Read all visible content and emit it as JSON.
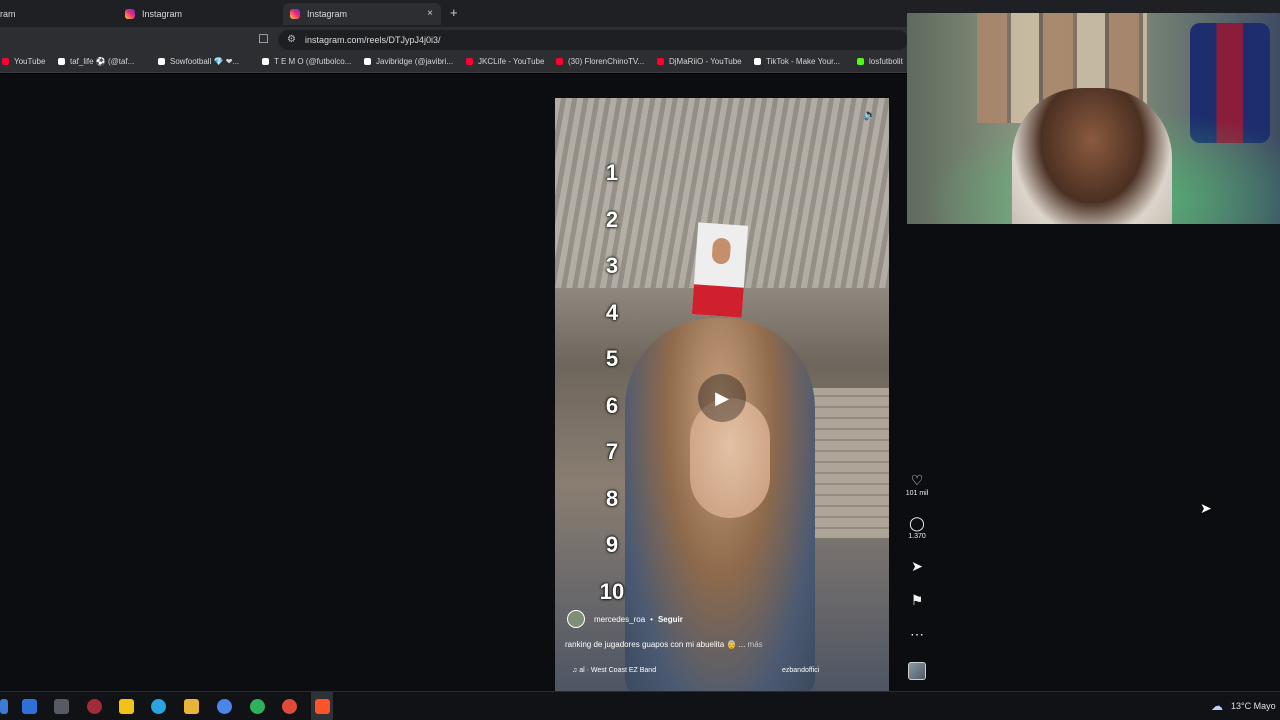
{
  "browser": {
    "tabs": [
      {
        "label": "ram",
        "active": false
      },
      {
        "label": "Instagram",
        "active": false
      },
      {
        "label": "Instagram",
        "active": true
      }
    ],
    "tab_close_glyph": "×",
    "new_tab_glyph": "+",
    "url": "instagram.com/reels/DTJypJ4j0i3/",
    "bookmarks": [
      {
        "label": "YouTube",
        "icon": "youtube-icon"
      },
      {
        "label": "taf_life ⚽ (@taf...",
        "icon": "tiktok-icon"
      },
      {
        "label": "Sowfootball 💎 ❤...",
        "icon": "tiktok-icon"
      },
      {
        "label": "T E M O (@futbolco...",
        "icon": "tiktok-icon"
      },
      {
        "label": "Javibridge (@javibri...",
        "icon": "tiktok-icon"
      },
      {
        "label": "JKCLife - YouTube",
        "icon": "youtube-icon"
      },
      {
        "label": "(30) FlorenChinoTV...",
        "icon": "youtube-icon"
      },
      {
        "label": "DjMaRiiO - YouTube",
        "icon": "youtube-icon"
      },
      {
        "label": "TikTok - Make Your...",
        "icon": "tiktok-icon"
      },
      {
        "label": "losfutbolit",
        "icon": "kick-icon"
      }
    ]
  },
  "reel": {
    "ranking": [
      "1",
      "2",
      "3",
      "4",
      "5",
      "6",
      "7",
      "8",
      "9",
      "10"
    ],
    "author": "mercedes_roa",
    "separator": "•",
    "follow_label": "Seguir",
    "caption": "ranking de jugadores guapos con mi abuelita 👵 ...",
    "caption_more": "más",
    "audio": "♫ al · West Coast EZ Band",
    "audio_user": "ezbandoffici",
    "likes": "101 mil",
    "comments": "1.370"
  },
  "taskbar": {
    "weather": "13°C",
    "weather_text": "Mayo"
  },
  "colors": {
    "page_bg": "#0b0d10",
    "chrome_bg": "#2d2e32",
    "youtube": "#ff0033",
    "kick": "#53fc18"
  }
}
